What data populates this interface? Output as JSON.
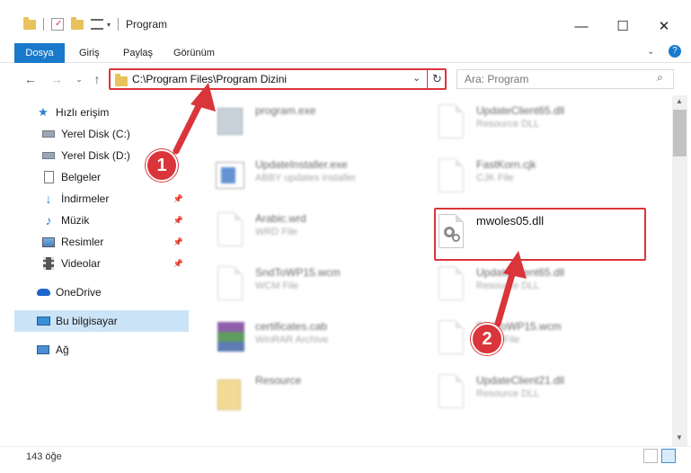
{
  "window": {
    "title": "Program",
    "controls": {
      "minimize": "—",
      "maximize": "☐",
      "close": "✕"
    }
  },
  "ribbon": {
    "tabs": [
      {
        "label": "Dosya",
        "active": true
      },
      {
        "label": "Giriş"
      },
      {
        "label": "Paylaş"
      },
      {
        "label": "Görünüm"
      }
    ]
  },
  "address": {
    "path": "C:\\Program Files\\Program Dizini",
    "search_placeholder": "Ara: Program"
  },
  "sidebar": {
    "items": [
      {
        "label": "Hızlı erişim",
        "icon": "star-icon"
      },
      {
        "label": "Yerel Disk (C:)",
        "icon": "drive-icon"
      },
      {
        "label": "Yerel Disk (D:)",
        "icon": "drive-icon"
      },
      {
        "label": "Belgeler",
        "icon": "documents-icon"
      },
      {
        "label": "İndirmeler",
        "icon": "download-icon"
      },
      {
        "label": "Müzik",
        "icon": "music-icon"
      },
      {
        "label": "Resimler",
        "icon": "pictures-icon"
      },
      {
        "label": "Videolar",
        "icon": "videos-icon"
      },
      {
        "label": "OneDrive",
        "icon": "cloud-icon"
      },
      {
        "label": "Bu bilgisayar",
        "icon": "computer-icon"
      },
      {
        "label": "Ağ",
        "icon": "network-icon"
      }
    ]
  },
  "files": [
    {
      "name": "program.exe",
      "type": ""
    },
    {
      "name": "UpdateClient65.dll",
      "type": "Resource DLL"
    },
    {
      "name": "UpdateInstaller.exe",
      "type": "ABBY updates installer"
    },
    {
      "name": "FastKorn.cjk",
      "type": "CJK File"
    },
    {
      "name": "Arabic.wrd",
      "type": "WRD File"
    },
    {
      "name": "mwoles05.dll",
      "type": ""
    },
    {
      "name": "SndToWP15.wcm",
      "type": "WCM File"
    },
    {
      "name": "UpdateClient65.dll",
      "type": "Resource DLL"
    },
    {
      "name": "certificates.cab",
      "type": "WinRAR Archive"
    },
    {
      "name": "SndToWP15.wcm",
      "type": "WCM File"
    },
    {
      "name": "Resource",
      "type": ""
    },
    {
      "name": "UpdateClient21.dll",
      "type": "Resource DLL"
    }
  ],
  "annotations": {
    "step1": "1",
    "step2": "2",
    "color": "#d9353a"
  },
  "status": {
    "item_count": "143 öğe"
  },
  "colors": {
    "accent": "#1979ca",
    "highlight": "#d9353a",
    "selected": "#cce4f7"
  }
}
